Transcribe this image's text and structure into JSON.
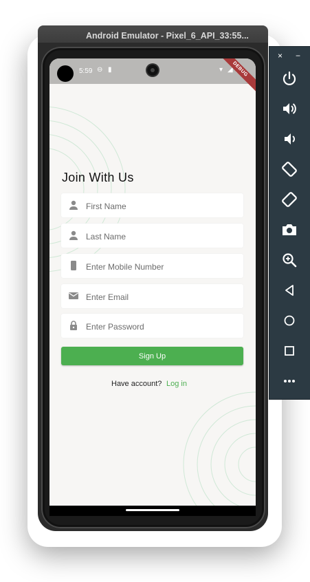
{
  "window": {
    "title": "Android Emulator - Pixel_6_API_33:55..."
  },
  "status_bar": {
    "time": "5:59",
    "debug_label": "DEBUG"
  },
  "form": {
    "title": "Join With Us",
    "fields": {
      "first_name": {
        "placeholder": "First Name",
        "icon": "person-icon"
      },
      "last_name": {
        "placeholder": "Last Name",
        "icon": "person-icon"
      },
      "mobile": {
        "placeholder": "Enter Mobile Number",
        "icon": "phone-icon"
      },
      "email": {
        "placeholder": "Enter Email",
        "icon": "mail-icon"
      },
      "password": {
        "placeholder": "Enter Password",
        "icon": "lock-icon"
      }
    },
    "signup_label": "Sign Up",
    "have_account": "Have account?",
    "login_label": "Log in"
  },
  "colors": {
    "accent": "#4caf50",
    "screen_bg": "#f7f6f4",
    "toolbar_bg": "#2c3a43"
  },
  "toolbar": {
    "close": "×",
    "minimize": "−",
    "tools": [
      "power-icon",
      "volume-up-icon",
      "volume-down-icon",
      "rotate-left-icon",
      "rotate-right-icon",
      "camera-icon",
      "zoom-icon",
      "back-icon",
      "home-icon",
      "overview-icon",
      "more-icon"
    ]
  }
}
